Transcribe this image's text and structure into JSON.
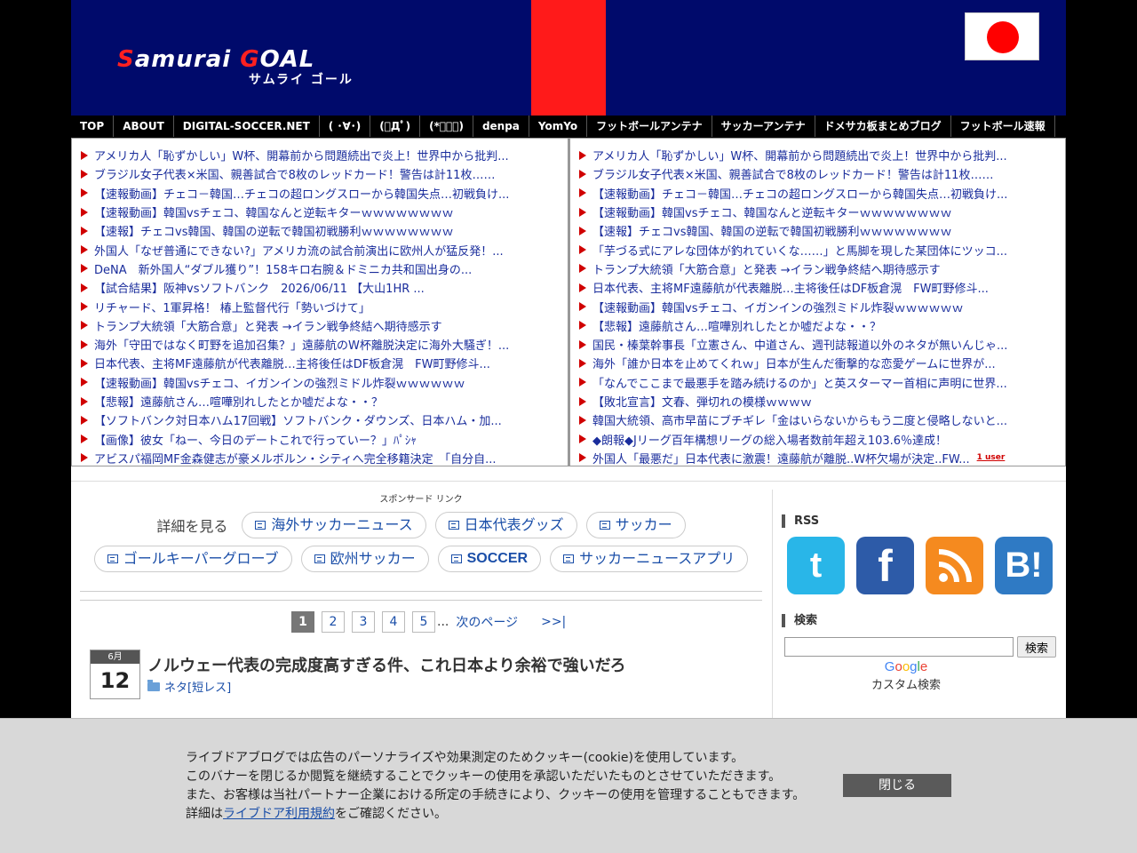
{
  "header": {
    "logo_main_r": "S",
    "logo_main_a": "amurai ",
    "logo_main_g": "G",
    "logo_main_b": "OAL",
    "logo_sub": "サムライ ゴール"
  },
  "nav": [
    "TOP",
    "ABOUT",
    "DIGITAL-SOCCER.NET",
    "( ･∀･)",
    "(ﾟДﾟ)",
    "(*ﾟｰﾟ)",
    "denpa",
    "YomYo",
    "フットボールアンテナ",
    "サッカーアンテナ",
    "ドメサカ板まとめブログ",
    "フットボール速報"
  ],
  "left_links": [
    "アメリカ人「恥ずかしい」W杯、開幕前から問題続出で炎上！世界中から批判...",
    "ブラジル女子代表×米国、親善試合で8枚のレッドカード！警告は計11枚……",
    "【速報動画】チェコ－韓国…チェコの超ロングスローから韓国失点…初戦負け...",
    "【速報動画】韓国vsチェコ、韓国なんと逆転キターｗｗｗｗｗｗｗｗ",
    "【速報】チェコvs韓国、韓国の逆転で韓国初戦勝利ｗｗｗｗｗｗｗｗ",
    "外国人「なぜ普通にできない?」アメリカ流の試合前演出に欧州人が猛反発！...",
    "DeNA　新外国人“ダブル獲り”！158キロ右腕＆ドミニカ共和国出身の...",
    "【試合結果】阪神vsソフトバンク　2026/06/11 【大山1HR ...",
    "リチャード、1軍昇格！ 椿上監督代行「勢いづけて」",
    "トランプ大統領「大筋合意」と発表 →イラン戦争終結へ期待感示す",
    "海外「守田ではなく町野を追加召集？」遠藤航のW杯離脱決定に海外大騒ぎ！...",
    "日本代表、主将MF遠藤航が代表離脱…主将後任はDF板倉滉　FW町野修斗...",
    "【速報動画】韓国vsチェコ、イガンインの強烈ミドル炸裂ｗｗｗｗｗｗ",
    "【悲報】遠藤航さん…喧嘩別れしたとか嘘だよな・・？",
    "【ソフトバンク対日本ハム17回戦】ソフトバンク・ダウンズ、日本ハム・加...",
    "【画像】彼女「ねー、今日のデートこれで行っていー？」ﾊﾟｼｬ",
    "アビスパ福岡MF金森健志が豪メルボルン・シティへ完全移籍決定　「自分自..."
  ],
  "right_links": [
    "アメリカ人「恥ずかしい」W杯、開幕前から問題続出で炎上！世界中から批判...",
    "ブラジル女子代表×米国、親善試合で8枚のレッドカード！警告は計11枚……",
    "【速報動画】チェコ－韓国…チェコの超ロングスローから韓国失点…初戦負け...",
    "【速報動画】韓国vsチェコ、韓国なんと逆転キターｗｗｗｗｗｗｗｗ",
    "【速報】チェコvs韓国、韓国の逆転で韓国初戦勝利ｗｗｗｗｗｗｗｗ",
    "「芋づる式にアレな団体が釣れていくな……」と馬脚を現した某団体にツッコ...",
    "トランプ大統領「大筋合意」と発表 →イラン戦争終結へ期待感示す",
    "日本代表、主将MF遠藤航が代表離脱…主将後任はDF板倉滉　FW町野修斗...",
    "【速報動画】韓国vsチェコ、イガンインの強烈ミドル炸裂ｗｗｗｗｗｗ",
    "【悲報】遠藤航さん…喧嘩別れしたとか嘘だよな・・？",
    "国民・榛葉幹事長「立憲さん、中道さん、週刊誌報道以外のネタが無いんじゃ...",
    "海外「誰か日本を止めてくれｗ」日本が生んだ衝撃的な恋愛ゲームに世界が...",
    "「なんでここまで最悪手を踏み続けるのか」と英スターマー首相に声明に世界...",
    "【敗北宣言】文春、弾切れの模様ｗｗｗｗ",
    "韓国大統領、高市早苗にブチギレ「金はいらないからもう二度と侵略しないと...",
    "◆朗報◆Jリーグ百年構想リーグの総入場者数前年超え103.6％達成！",
    "外国人「最悪だ」日本代表に激震！遠藤航が離脱..W杯欠場が決定..FW..."
  ],
  "user_badge": "1 user",
  "ads": {
    "sponsor": "スポンサード リンク",
    "label": "詳細を見る",
    "row1": [
      "海外サッカーニュース",
      "日本代表グッズ",
      "サッカー"
    ],
    "row2": [
      "ゴールキーパーグローブ",
      "欧州サッカー",
      "SOCCER",
      "サッカーニュースアプリ"
    ]
  },
  "pager": {
    "pages": [
      "1",
      "2",
      "3",
      "4",
      "5"
    ],
    "dots": "...",
    "next": "次のページ",
    "last": ">>|"
  },
  "article": {
    "month": "6月",
    "day": "12",
    "title": "ノルウェー代表の完成度高すぎる件、これ日本より余裕で強いだろ",
    "category": "ネタ[短レス]"
  },
  "sidebar": {
    "rss_heading": "RSS",
    "search_heading": "検索",
    "search_button": "検索",
    "google": [
      "G",
      "o",
      "o",
      "g",
      "l",
      "e"
    ],
    "custom_search": "カスタム検索",
    "social": [
      "twitter-icon",
      "facebook-icon",
      "rss-icon",
      "hatena-bookmark-icon"
    ]
  },
  "cookie": {
    "line1": "ライブドアブログでは広告のパーソナライズや効果測定のためクッキー(cookie)を使用しています。",
    "line2": "このバナーを閉じるか閲覧を継続することでクッキーの使用を承認いただいたものとさせていただきます。",
    "line3": "また、お客様は当社パートナー企業における所定の手続きにより、クッキーの使用を管理することもできます。",
    "line4_pre": "詳細は",
    "line4_link": "ライブドア利用規約",
    "line4_post": "をご確認ください。",
    "close": "閉じる"
  },
  "colors": {
    "header_bg": "#000a6b",
    "stripe": "#ff1a1a",
    "link": "#1a2d9c",
    "arrow": "#d00000"
  }
}
